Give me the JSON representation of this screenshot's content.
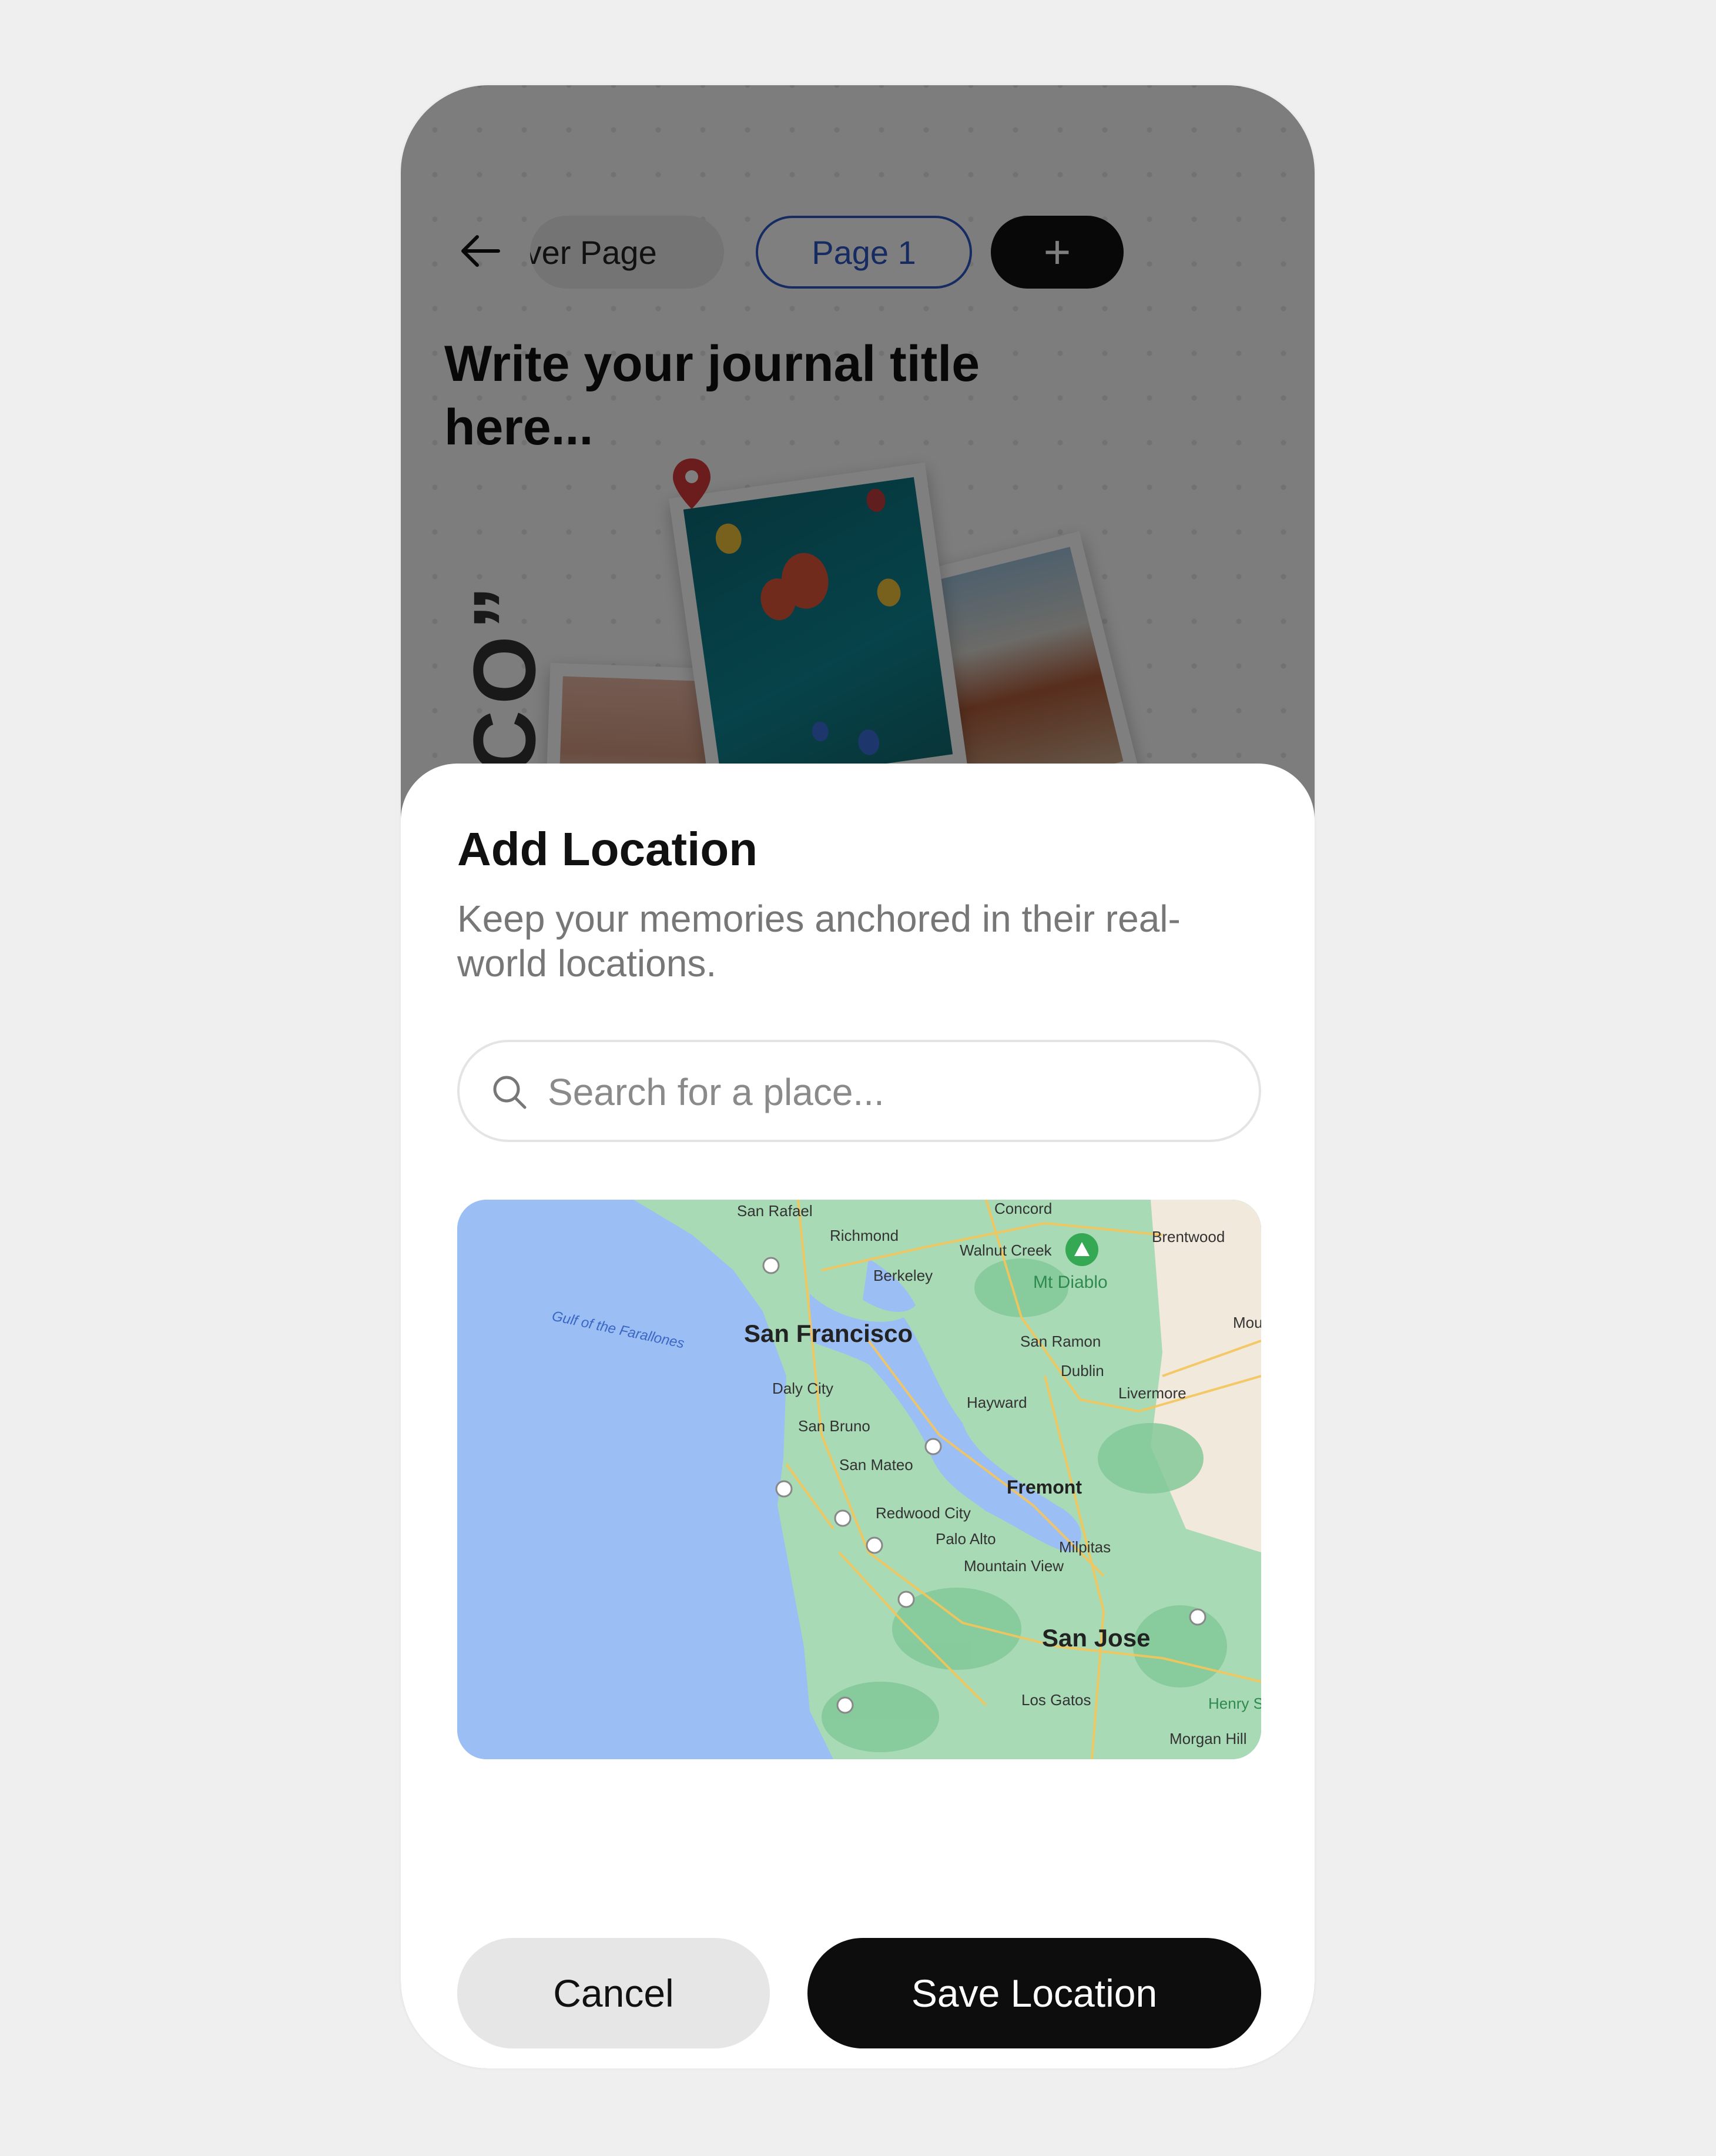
{
  "journal": {
    "back_label": "Back",
    "tabs": [
      {
        "label": "Cover Page"
      },
      {
        "label": "Page 1"
      }
    ],
    "add_page_label": "+",
    "title_placeholder": "Write your journal title here...",
    "vertical_text": "CCO”"
  },
  "modal": {
    "title": "Add Location",
    "subtitle": "Keep your memories anchored in their real-world locations.",
    "search": {
      "placeholder": "Search for a place..."
    },
    "map": {
      "water_label": "Gulf of the Farallones",
      "places": [
        {
          "name": "San Francisco",
          "major": true
        },
        {
          "name": "San Jose",
          "major": true
        },
        {
          "name": "Fremont",
          "major": true
        },
        {
          "name": "San Rafael"
        },
        {
          "name": "Richmond"
        },
        {
          "name": "Concord"
        },
        {
          "name": "Walnut Creek"
        },
        {
          "name": "Brentwood"
        },
        {
          "name": "Berkeley"
        },
        {
          "name": "Mt Diablo"
        },
        {
          "name": "San Ramon"
        },
        {
          "name": "Dublin"
        },
        {
          "name": "Livermore"
        },
        {
          "name": "Hayward"
        },
        {
          "name": "Daly City"
        },
        {
          "name": "San Bruno"
        },
        {
          "name": "San Mateo"
        },
        {
          "name": "Redwood City"
        },
        {
          "name": "Palo Alto"
        },
        {
          "name": "Milpitas"
        },
        {
          "name": "Mountain View"
        },
        {
          "name": "Los Gatos"
        },
        {
          "name": "Morgan Hill"
        },
        {
          "name": "Henry State"
        },
        {
          "name": "Mou Ho"
        }
      ]
    },
    "cancel_label": "Cancel",
    "save_label": "Save Location"
  },
  "colors": {
    "accent": "#2c57c4",
    "primary_button": "#0d0d0d",
    "secondary_button": "#e6e6e6",
    "map_water": "#9bbff4",
    "map_land": "#a8dab5",
    "pin": "#d63b3b"
  }
}
